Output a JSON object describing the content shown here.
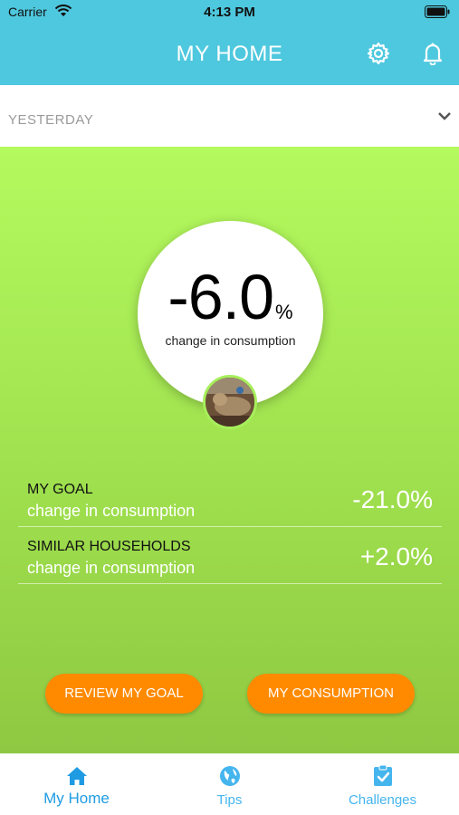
{
  "status_bar": {
    "carrier": "Carrier",
    "time": "4:13 PM"
  },
  "header": {
    "title": "MY HOME"
  },
  "period": {
    "selected": "YESTERDAY"
  },
  "summary": {
    "value": "-6.0",
    "unit": "%",
    "caption": "change in consumption"
  },
  "comparisons": [
    {
      "title": "MY GOAL",
      "subtitle": "change in consumption",
      "value": "-21.0%"
    },
    {
      "title": "SIMILAR HOUSEHOLDS",
      "subtitle": "change in consumption",
      "value": "+2.0%"
    }
  ],
  "buttons": {
    "review_goal": "REVIEW MY GOAL",
    "my_consumption": "MY CONSUMPTION"
  },
  "tabs": [
    {
      "label": "My Home",
      "icon": "home-icon"
    },
    {
      "label": "Tips",
      "icon": "globe-icon"
    },
    {
      "label": "Challenges",
      "icon": "clipboard-check-icon"
    }
  ],
  "colors": {
    "header": "#4ec8de",
    "accent_orange": "#ff8a00",
    "green_top": "#b4fa5e",
    "green_bottom": "#8fc842",
    "tab_active": "#1e9be2"
  }
}
